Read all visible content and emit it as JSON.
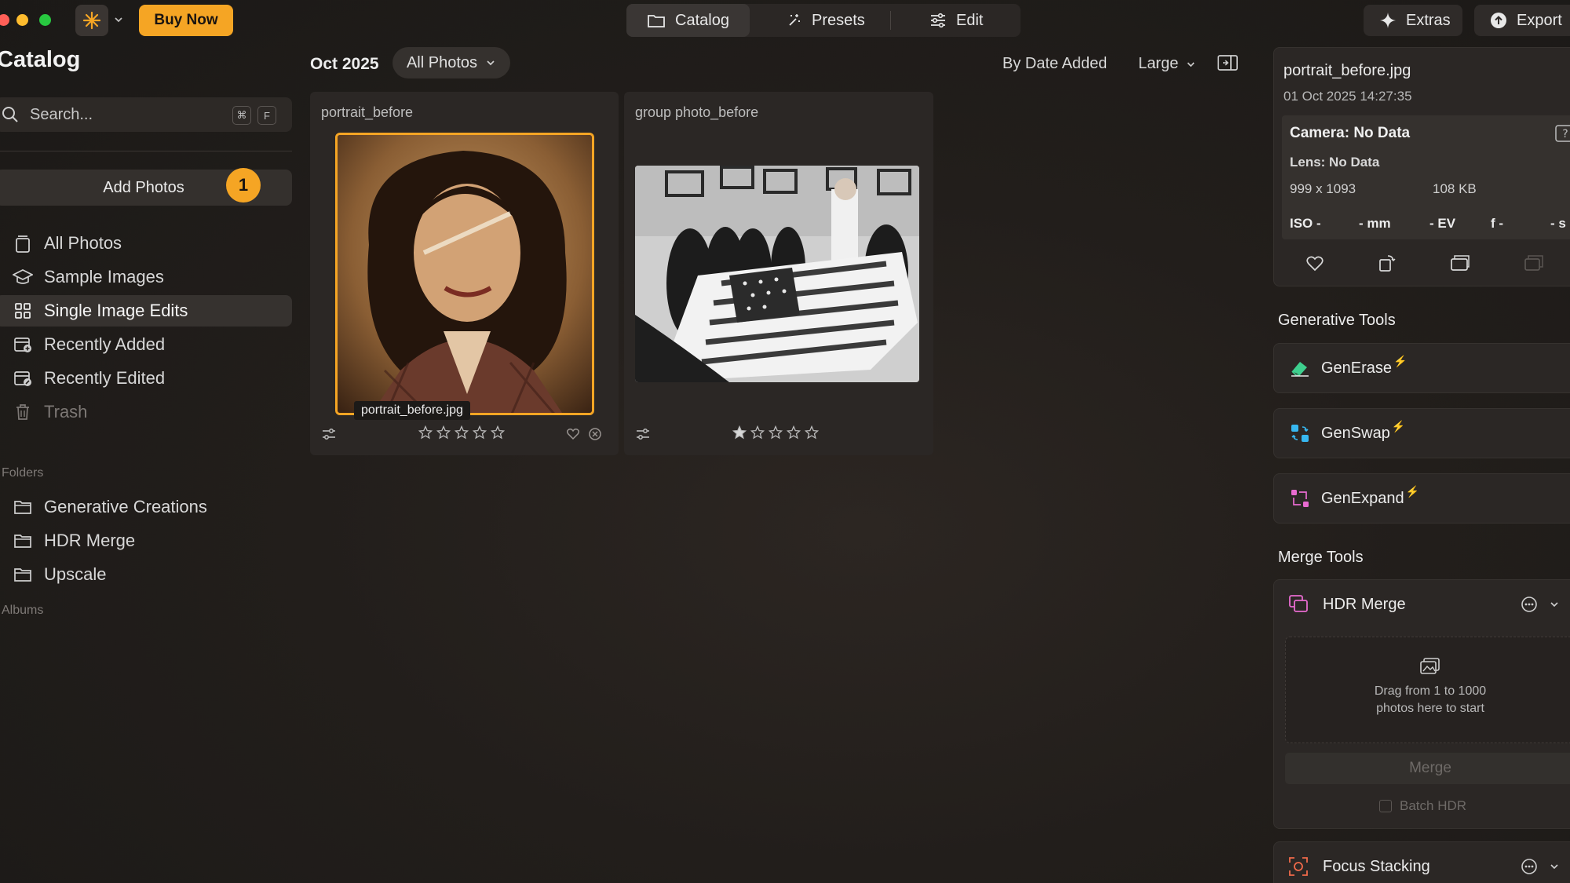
{
  "toolbar": {
    "buy_now": "Buy Now",
    "tabs": [
      {
        "label": "Catalog",
        "icon": "folder-icon",
        "active": true
      },
      {
        "label": "Presets",
        "icon": "sparkle-wand-icon",
        "active": false
      },
      {
        "label": "Edit",
        "icon": "sliders-icon",
        "active": false
      }
    ],
    "extras": "Extras",
    "export": "Export"
  },
  "sidebar": {
    "title": "Catalog",
    "search_placeholder": "Search...",
    "shortcut_keys": [
      "⌘",
      "F"
    ],
    "add_photos": "Add Photos",
    "add_photos_badge": "1",
    "items": [
      {
        "label": "All Photos",
        "icon": "photos-stack-icon"
      },
      {
        "label": "Sample Images",
        "icon": "graduation-cap-icon"
      },
      {
        "label": "Single Image Edits",
        "icon": "grid-icon",
        "selected": true
      },
      {
        "label": "Recently Added",
        "icon": "calendar-add-icon"
      },
      {
        "label": "Recently Edited",
        "icon": "calendar-edit-icon"
      },
      {
        "label": "Trash",
        "icon": "trash-icon",
        "dim": true
      }
    ],
    "folders_label": "Folders",
    "folders": [
      {
        "label": "Generative Creations"
      },
      {
        "label": "HDR Merge"
      },
      {
        "label": "Upscale"
      }
    ],
    "albums_label": "Albums"
  },
  "main": {
    "month": "Oct 2025",
    "filter": "All Photos",
    "sort": "By Date Added",
    "size": "Large",
    "cards": [
      {
        "title": "portrait_before",
        "filename": "portrait_before.jpg",
        "rating": 0
      },
      {
        "title": "group photo_before",
        "rating": 1
      }
    ]
  },
  "info": {
    "filename": "portrait_before.jpg",
    "date": "01 Oct 2025 14:27:35",
    "camera": "Camera: No Data",
    "lens": "Lens: No Data",
    "dimensions": "999 x 1093",
    "filesize": "108 KB",
    "iso": "ISO -",
    "focal": "- mm",
    "ev": "- EV",
    "aperture": "f -",
    "shutter": "- s"
  },
  "generative_tools": {
    "heading": "Generative Tools",
    "items": [
      {
        "label": "GenErase",
        "color": "#3ecf8e"
      },
      {
        "label": "GenSwap",
        "color": "#37b7f0"
      },
      {
        "label": "GenExpand",
        "color": "#e86bd0"
      }
    ],
    "bolt": "⚡"
  },
  "merge_tools": {
    "heading": "Merge Tools",
    "hdr_title": "HDR Merge",
    "drop_line1": "Drag from 1 to 1000",
    "drop_line2": "photos here to start",
    "merge_button": "Merge",
    "batch_label": "Batch HDR",
    "focus_title": "Focus Stacking"
  },
  "colors": {
    "accent": "#f5a524",
    "traffic_red": "#ff5f57",
    "traffic_yellow": "#febc2e",
    "traffic_green": "#28c840"
  }
}
